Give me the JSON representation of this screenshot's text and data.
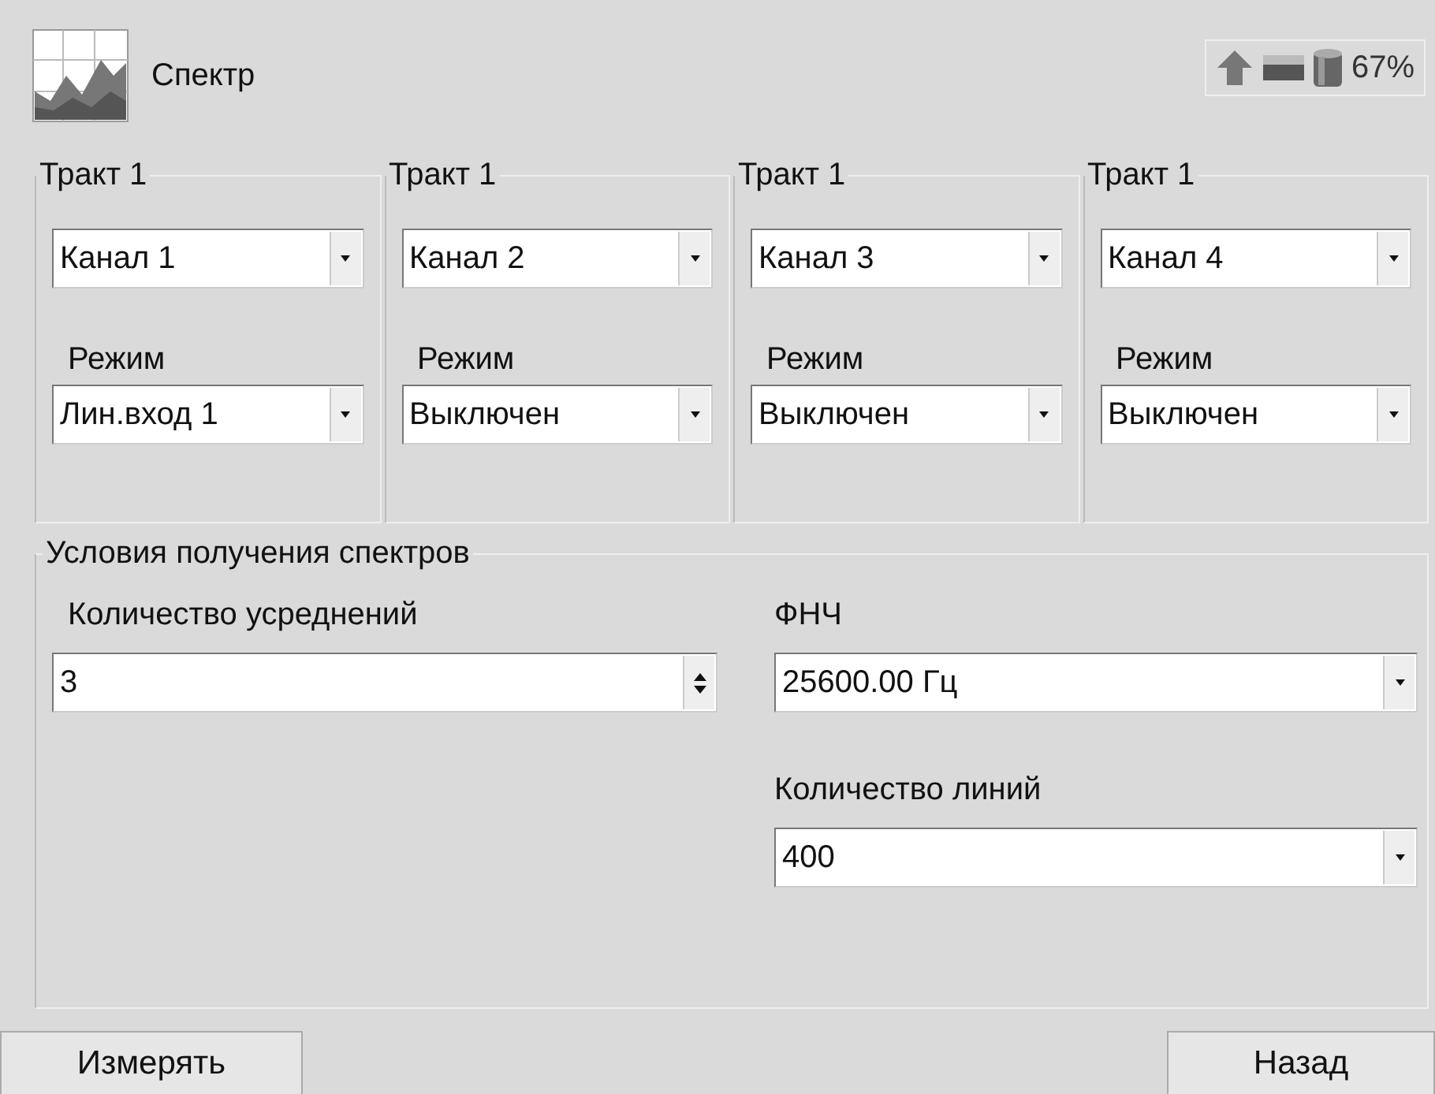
{
  "header": {
    "title": "Спектр",
    "battery": "67%"
  },
  "tracks": [
    {
      "title": "Тракт 1",
      "channel": "Канал 1",
      "mode_label": "Режим",
      "mode": "Лин.вход 1"
    },
    {
      "title": "Тракт 1",
      "channel": "Канал 2",
      "mode_label": "Режим",
      "mode": "Выключен"
    },
    {
      "title": "Тракт 1",
      "channel": "Канал 3",
      "mode_label": "Режим",
      "mode": "Выключен"
    },
    {
      "title": "Тракт 1",
      "channel": "Канал 4",
      "mode_label": "Режим",
      "mode": "Выключен"
    }
  ],
  "conditions": {
    "title": "Условия получения спектров",
    "averages": {
      "label": "Количество усреднений",
      "value": "3"
    },
    "lpf": {
      "label": "ФНЧ",
      "value": "25600.00 Гц"
    },
    "lines": {
      "label": "Количество линий",
      "value": "400"
    }
  },
  "buttons": [
    {
      "label": "Измерять"
    },
    {
      "label": "Назад"
    }
  ]
}
